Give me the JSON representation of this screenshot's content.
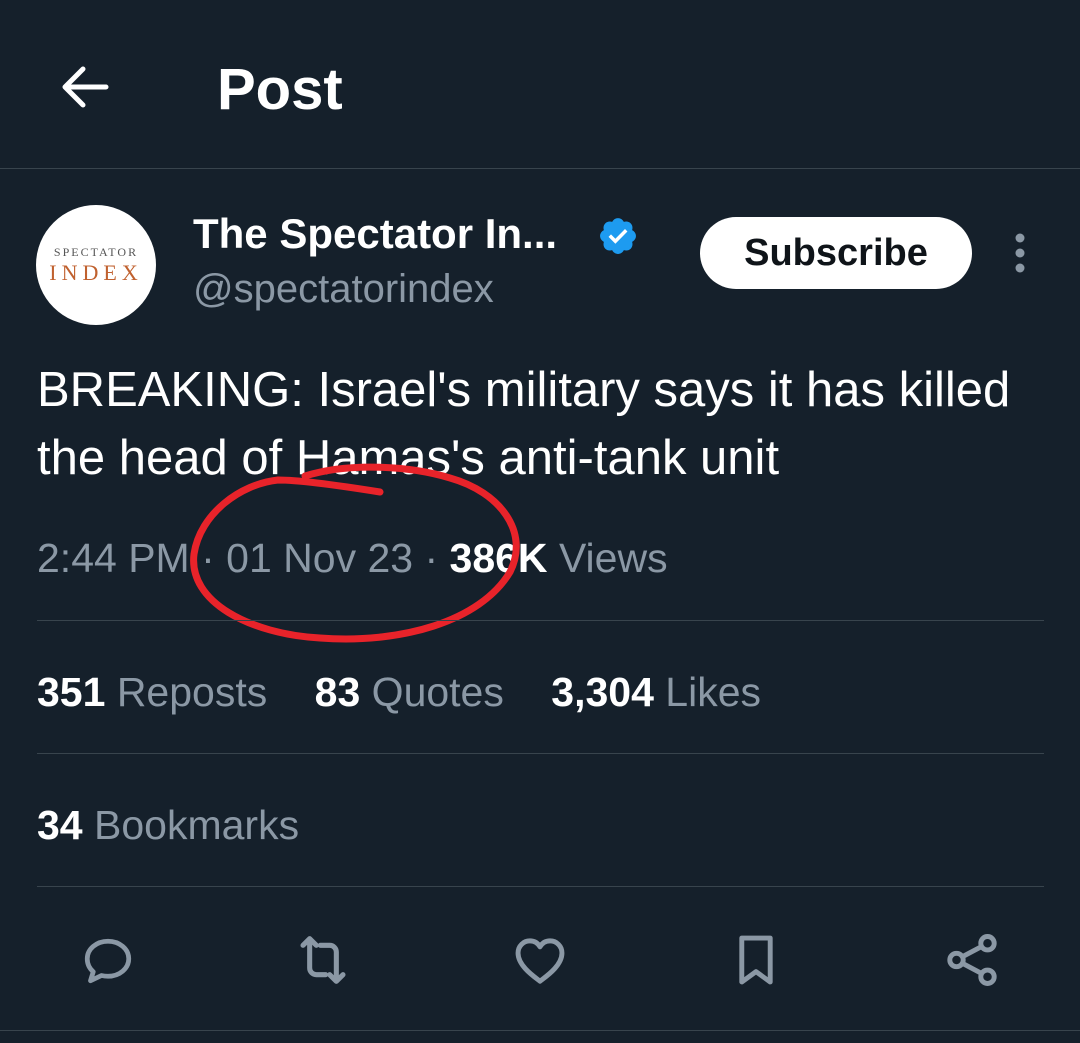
{
  "header": {
    "title": "Post",
    "back_icon": "arrow-left-icon"
  },
  "author": {
    "name": "The Spectator In...",
    "handle": "@spectatorindex",
    "verified": true,
    "avatar_text_top": "SPECTATOR",
    "avatar_text_bottom": "INDEX",
    "subscribe_label": "Subscribe"
  },
  "post": {
    "text": "BREAKING: Israel's military says it has killed the head of Hamas's anti-tank unit",
    "time": "2:44 PM",
    "date": "01 Nov 23",
    "views_count": "386K",
    "views_label": "Views"
  },
  "stats": {
    "reposts_count": "351",
    "reposts_label": "Reposts",
    "quotes_count": "83",
    "quotes_label": "Quotes",
    "likes_count": "3,304",
    "likes_label": "Likes",
    "bookmarks_count": "34",
    "bookmarks_label": "Bookmarks"
  },
  "actions": [
    "reply-icon",
    "repost-icon",
    "like-icon",
    "bookmark-icon",
    "share-icon"
  ],
  "colors": {
    "background": "#15202b",
    "text_primary": "#ffffff",
    "text_secondary": "#8b98a5",
    "divider": "#38444d",
    "verified_blue": "#1d9bf0",
    "annotation_red": "#e8232a"
  }
}
